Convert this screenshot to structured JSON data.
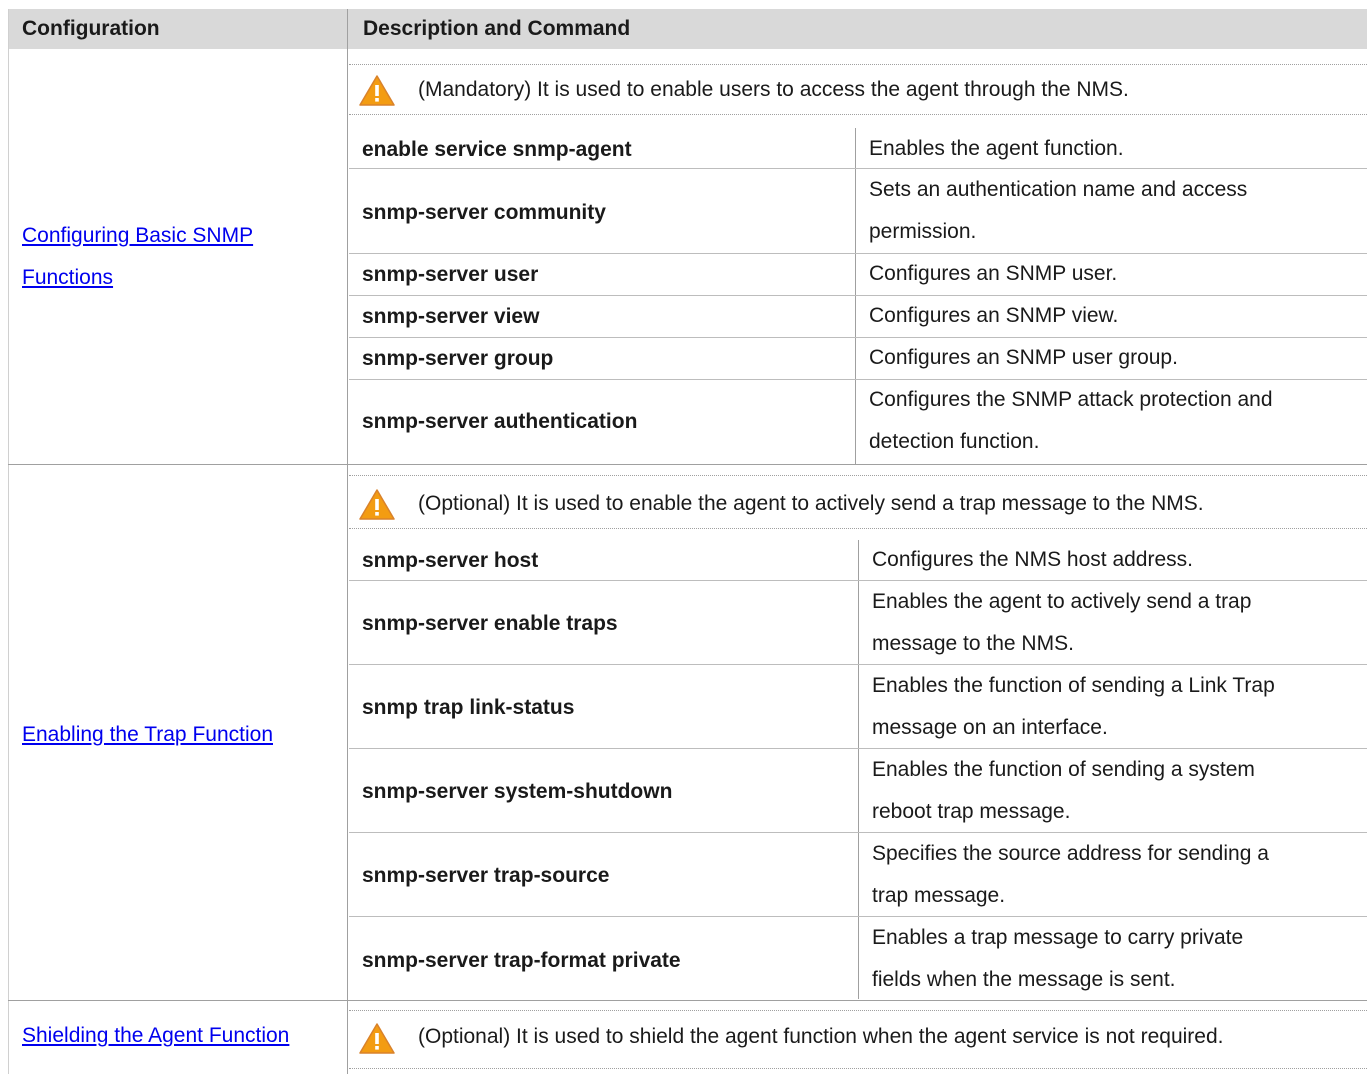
{
  "header": {
    "configuration": "Configuration",
    "description_and_command": "Description and Command"
  },
  "sections": [
    {
      "configuration": "Configuring Basic SNMP Functions",
      "config_lines": [
        "Configuring Basic SNMP ",
        "Functions"
      ],
      "note_icon": "warning-icon",
      "note": "(Mandatory) It is used to enable users to access the agent through the NMS.",
      "rows": [
        {
          "command": "enable service snmp-agent",
          "description": "Enables the agent function."
        },
        {
          "command": "snmp-server community",
          "description": "Sets an authentication name and access permission.",
          "desc_lines": [
            "Sets an authentication name and access",
            "permission."
          ]
        },
        {
          "command": "snmp-server user",
          "description": "Configures an SNMP user."
        },
        {
          "command": "snmp-server view",
          "description": "Configures an SNMP view."
        },
        {
          "command": "snmp-server group",
          "description": "Configures an SNMP user group."
        },
        {
          "command": "snmp-server authentication",
          "description": "Configures the SNMP attack protection and detection function.",
          "desc_lines": [
            "Configures the SNMP attack protection and",
            "detection function."
          ]
        }
      ]
    },
    {
      "configuration": "Enabling the Trap Function",
      "note_icon": "warning-icon",
      "note": "(Optional) It is used to enable the agent to actively send a trap message to the NMS.",
      "rows": [
        {
          "command": "snmp-server host",
          "description": "Configures the NMS host address."
        },
        {
          "command": "snmp-server enable traps",
          "description": "Enables the agent to actively send a trap message to the NMS.",
          "desc_lines": [
            "Enables the agent to actively send a trap",
            "message to the NMS."
          ]
        },
        {
          "command": "snmp trap link-status",
          "description": "Enables the function of sending a Link Trap message on an interface.",
          "desc_lines": [
            "Enables the function of sending a Link Trap",
            "message on an interface."
          ]
        },
        {
          "command": "snmp-server system-shutdown",
          "description": "Enables the function of sending a system reboot trap message.",
          "desc_lines": [
            "Enables the function of sending a system",
            "reboot trap message."
          ]
        },
        {
          "command": "snmp-server trap-source",
          "description": "Specifies the source address for sending a trap message.",
          "desc_lines": [
            "Specifies the source address for sending a",
            "trap message."
          ]
        },
        {
          "command": "snmp-server trap-format private",
          "description": "Enables a trap message to carry private fields when the message is sent.",
          "desc_lines": [
            "Enables a trap message to carry private",
            "fields when the message is sent."
          ]
        }
      ]
    },
    {
      "configuration": "Shielding the Agent Function",
      "note_icon": "warning-icon",
      "note": "(Optional) It is used to shield the agent function when the agent service is not required."
    }
  ],
  "colors": {
    "header_bg": "#d9d9d9",
    "link": "#0000ee",
    "warning_fill": "#f39c12",
    "border": "#a0a0a0"
  }
}
